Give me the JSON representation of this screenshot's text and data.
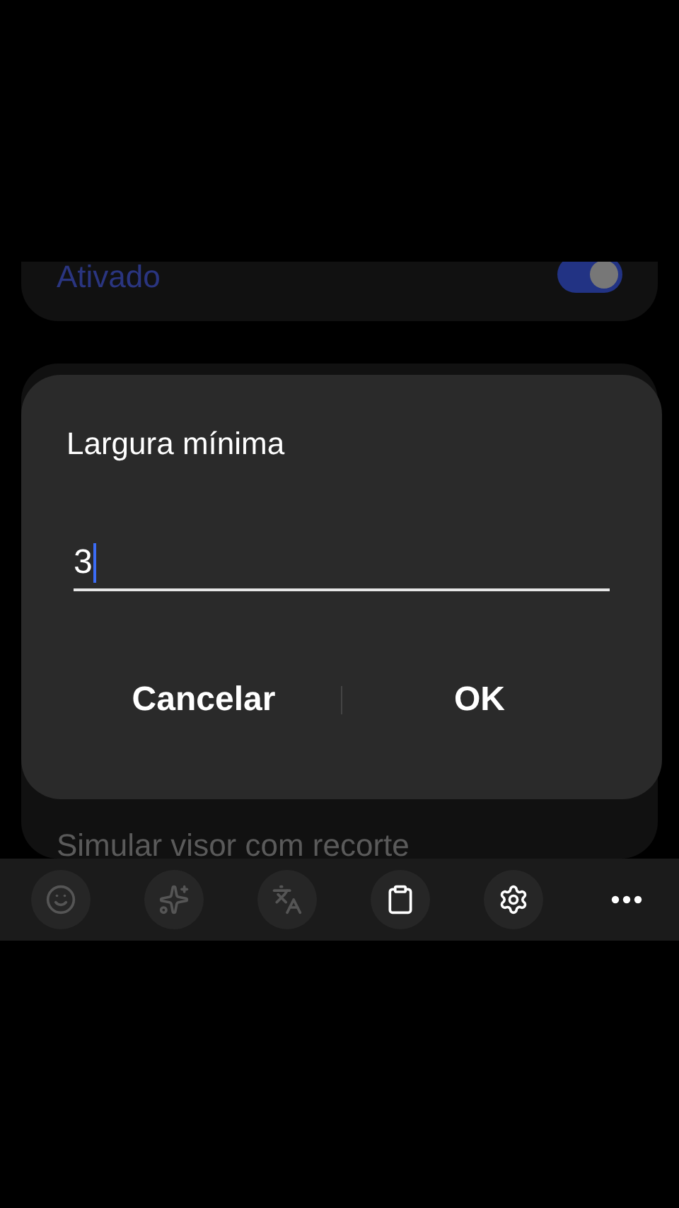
{
  "setting_card": {
    "label": "Ativado",
    "on": true
  },
  "dialog": {
    "title": "Largura mínima",
    "field": {
      "value": "3",
      "focused": true
    },
    "buttons": [
      {
        "label": "Cancelar"
      },
      {
        "label": "OK"
      }
    ]
  },
  "next_setting": {
    "label": "Simular visor com recorte"
  },
  "keyboard_toolbar": [
    {
      "kind": "emoji",
      "disabled": true
    },
    {
      "kind": "sparkle",
      "disabled": true
    },
    {
      "kind": "translate",
      "disabled": true
    },
    {
      "kind": "clipboard",
      "disabled": false
    },
    {
      "kind": "settings",
      "disabled": false
    },
    {
      "kind": "more",
      "disabled": false
    }
  ]
}
